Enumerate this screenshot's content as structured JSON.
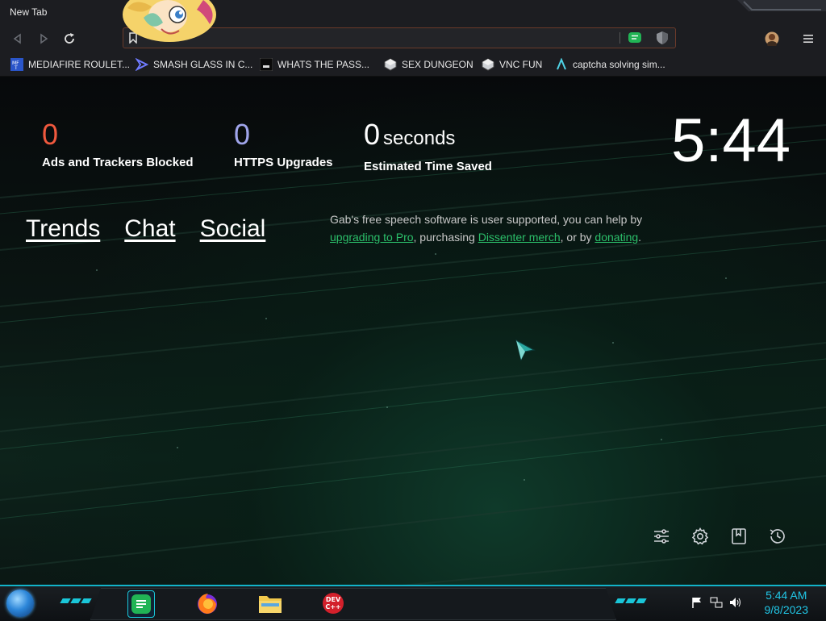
{
  "browser": {
    "tab_title": "New Tab",
    "bookmarks": [
      {
        "label": "MEDIAFIRE ROULET...",
        "icon": "mediafire-icon"
      },
      {
        "label": "SMASH GLASS IN C...",
        "icon": "smash-icon"
      },
      {
        "label": "WHATS THE PASS...",
        "icon": "terminal-icon"
      },
      {
        "label": "SEX DUNGEON",
        "icon": "cube-icon"
      },
      {
        "label": "VNC FUN",
        "icon": "cube-icon"
      },
      {
        "label": "captcha solving sim...",
        "icon": "captcha-icon"
      }
    ]
  },
  "stats": {
    "ads_blocked": {
      "value": "0",
      "label": "Ads and Trackers Blocked",
      "color": "#f0593e"
    },
    "https_upgrades": {
      "value": "0",
      "label": "HTTPS Upgrades",
      "color": "#a0a5eb"
    },
    "time_saved": {
      "value": "0",
      "unit": "seconds",
      "label": "Estimated Time Saved"
    }
  },
  "clock": "5:44",
  "links": {
    "trends": "Trends",
    "chat": "Chat",
    "social": "Social"
  },
  "gab": {
    "part1": "Gab's free speech software is user supported, you can help by ",
    "link1": "upgrading to Pro",
    "part2": ", purchasing ",
    "link2": "Dissenter merch",
    "part3": ", or by ",
    "link3": "donating",
    "part4": "."
  },
  "taskbar": {
    "time": "5:44 AM",
    "date": "9/8/2023",
    "accent": "#1ac6d8"
  }
}
